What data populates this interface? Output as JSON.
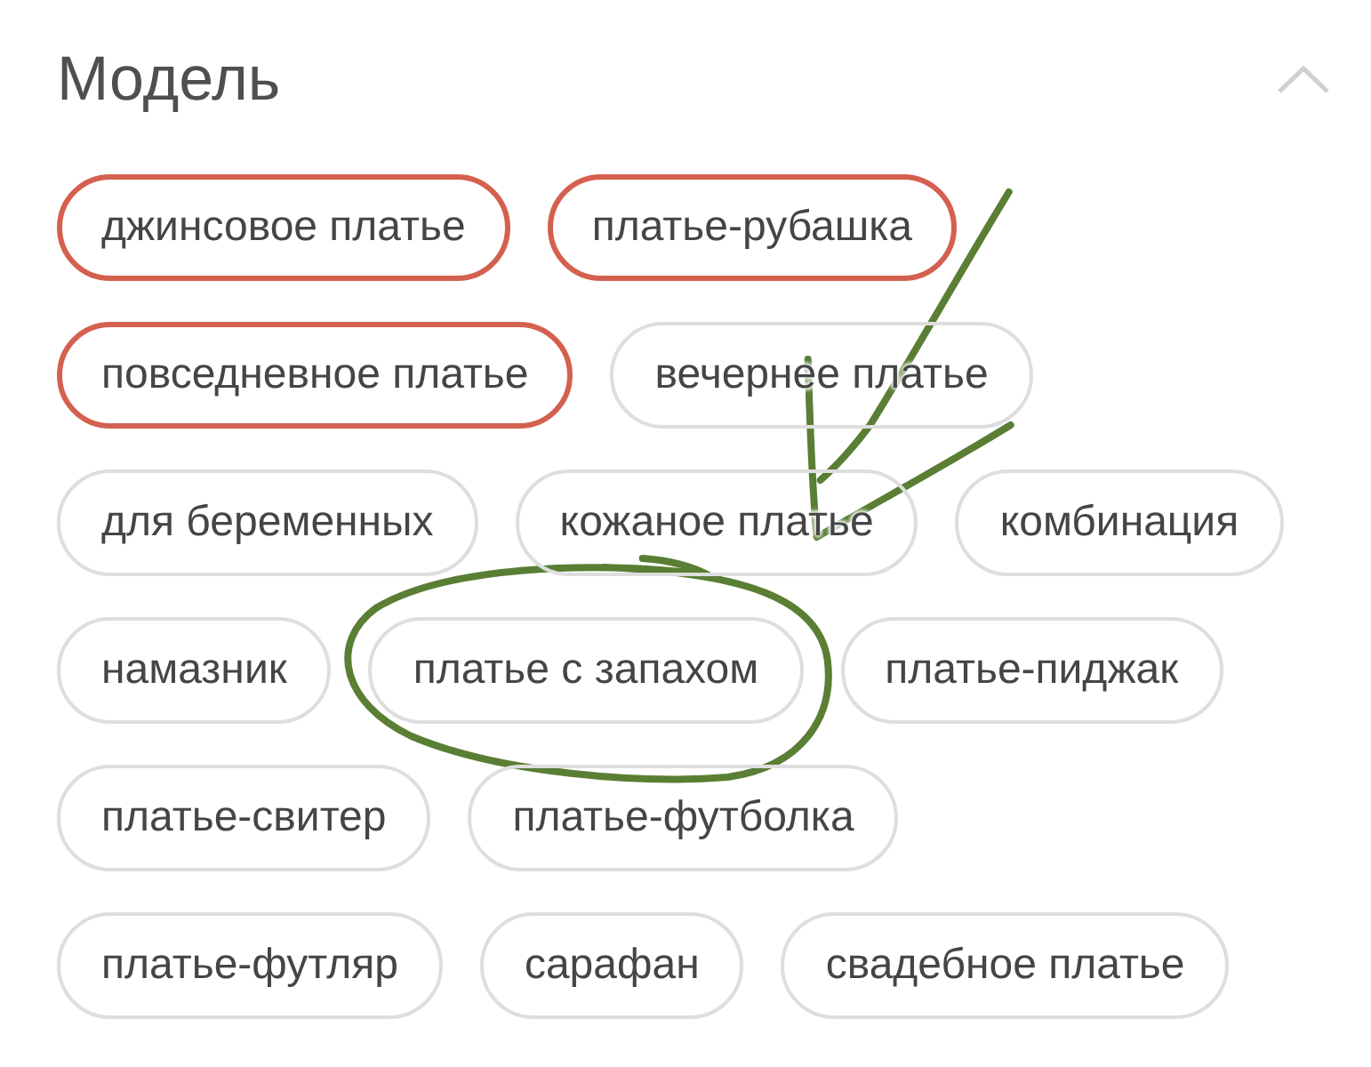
{
  "section": {
    "title": "Модель",
    "expanded": true,
    "chips": [
      {
        "label": "джинсовое платье",
        "selected": true,
        "marked": false
      },
      {
        "label": "платье-рубашка",
        "selected": true,
        "marked": false
      },
      {
        "label": "повседневное платье",
        "selected": true,
        "marked": false
      },
      {
        "label": "вечернее платье",
        "selected": false,
        "marked": false
      },
      {
        "label": "для беременных",
        "selected": false,
        "marked": false
      },
      {
        "label": "кожаное платье",
        "selected": false,
        "marked": false
      },
      {
        "label": "комбинация",
        "selected": false,
        "marked": false
      },
      {
        "label": "намазник",
        "selected": false,
        "marked": false
      },
      {
        "label": "платье с запахом",
        "selected": false,
        "marked": true
      },
      {
        "label": "платье-пиджак",
        "selected": false,
        "marked": false
      },
      {
        "label": "платье-свитер",
        "selected": false,
        "marked": false
      },
      {
        "label": "платье-футболка",
        "selected": false,
        "marked": false
      },
      {
        "label": "платье-футляр",
        "selected": false,
        "marked": false
      },
      {
        "label": "сарафан",
        "selected": false,
        "marked": false
      },
      {
        "label": "свадебное платье",
        "selected": false,
        "marked": false
      }
    ]
  }
}
